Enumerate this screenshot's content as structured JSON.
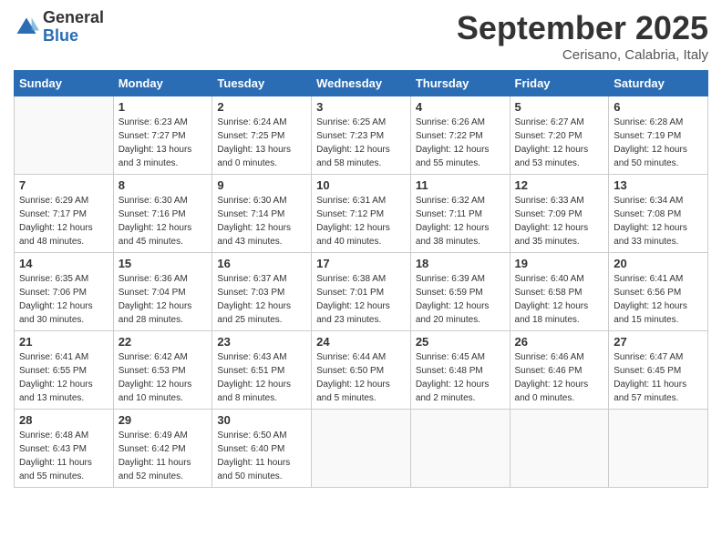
{
  "header": {
    "logo_general": "General",
    "logo_blue": "Blue",
    "month": "September 2025",
    "location": "Cerisano, Calabria, Italy"
  },
  "days_of_week": [
    "Sunday",
    "Monday",
    "Tuesday",
    "Wednesday",
    "Thursday",
    "Friday",
    "Saturday"
  ],
  "weeks": [
    [
      {
        "day": "",
        "info": ""
      },
      {
        "day": "1",
        "info": "Sunrise: 6:23 AM\nSunset: 7:27 PM\nDaylight: 13 hours\nand 3 minutes."
      },
      {
        "day": "2",
        "info": "Sunrise: 6:24 AM\nSunset: 7:25 PM\nDaylight: 13 hours\nand 0 minutes."
      },
      {
        "day": "3",
        "info": "Sunrise: 6:25 AM\nSunset: 7:23 PM\nDaylight: 12 hours\nand 58 minutes."
      },
      {
        "day": "4",
        "info": "Sunrise: 6:26 AM\nSunset: 7:22 PM\nDaylight: 12 hours\nand 55 minutes."
      },
      {
        "day": "5",
        "info": "Sunrise: 6:27 AM\nSunset: 7:20 PM\nDaylight: 12 hours\nand 53 minutes."
      },
      {
        "day": "6",
        "info": "Sunrise: 6:28 AM\nSunset: 7:19 PM\nDaylight: 12 hours\nand 50 minutes."
      }
    ],
    [
      {
        "day": "7",
        "info": "Sunrise: 6:29 AM\nSunset: 7:17 PM\nDaylight: 12 hours\nand 48 minutes."
      },
      {
        "day": "8",
        "info": "Sunrise: 6:30 AM\nSunset: 7:16 PM\nDaylight: 12 hours\nand 45 minutes."
      },
      {
        "day": "9",
        "info": "Sunrise: 6:30 AM\nSunset: 7:14 PM\nDaylight: 12 hours\nand 43 minutes."
      },
      {
        "day": "10",
        "info": "Sunrise: 6:31 AM\nSunset: 7:12 PM\nDaylight: 12 hours\nand 40 minutes."
      },
      {
        "day": "11",
        "info": "Sunrise: 6:32 AM\nSunset: 7:11 PM\nDaylight: 12 hours\nand 38 minutes."
      },
      {
        "day": "12",
        "info": "Sunrise: 6:33 AM\nSunset: 7:09 PM\nDaylight: 12 hours\nand 35 minutes."
      },
      {
        "day": "13",
        "info": "Sunrise: 6:34 AM\nSunset: 7:08 PM\nDaylight: 12 hours\nand 33 minutes."
      }
    ],
    [
      {
        "day": "14",
        "info": "Sunrise: 6:35 AM\nSunset: 7:06 PM\nDaylight: 12 hours\nand 30 minutes."
      },
      {
        "day": "15",
        "info": "Sunrise: 6:36 AM\nSunset: 7:04 PM\nDaylight: 12 hours\nand 28 minutes."
      },
      {
        "day": "16",
        "info": "Sunrise: 6:37 AM\nSunset: 7:03 PM\nDaylight: 12 hours\nand 25 minutes."
      },
      {
        "day": "17",
        "info": "Sunrise: 6:38 AM\nSunset: 7:01 PM\nDaylight: 12 hours\nand 23 minutes."
      },
      {
        "day": "18",
        "info": "Sunrise: 6:39 AM\nSunset: 6:59 PM\nDaylight: 12 hours\nand 20 minutes."
      },
      {
        "day": "19",
        "info": "Sunrise: 6:40 AM\nSunset: 6:58 PM\nDaylight: 12 hours\nand 18 minutes."
      },
      {
        "day": "20",
        "info": "Sunrise: 6:41 AM\nSunset: 6:56 PM\nDaylight: 12 hours\nand 15 minutes."
      }
    ],
    [
      {
        "day": "21",
        "info": "Sunrise: 6:41 AM\nSunset: 6:55 PM\nDaylight: 12 hours\nand 13 minutes."
      },
      {
        "day": "22",
        "info": "Sunrise: 6:42 AM\nSunset: 6:53 PM\nDaylight: 12 hours\nand 10 minutes."
      },
      {
        "day": "23",
        "info": "Sunrise: 6:43 AM\nSunset: 6:51 PM\nDaylight: 12 hours\nand 8 minutes."
      },
      {
        "day": "24",
        "info": "Sunrise: 6:44 AM\nSunset: 6:50 PM\nDaylight: 12 hours\nand 5 minutes."
      },
      {
        "day": "25",
        "info": "Sunrise: 6:45 AM\nSunset: 6:48 PM\nDaylight: 12 hours\nand 2 minutes."
      },
      {
        "day": "26",
        "info": "Sunrise: 6:46 AM\nSunset: 6:46 PM\nDaylight: 12 hours\nand 0 minutes."
      },
      {
        "day": "27",
        "info": "Sunrise: 6:47 AM\nSunset: 6:45 PM\nDaylight: 11 hours\nand 57 minutes."
      }
    ],
    [
      {
        "day": "28",
        "info": "Sunrise: 6:48 AM\nSunset: 6:43 PM\nDaylight: 11 hours\nand 55 minutes."
      },
      {
        "day": "29",
        "info": "Sunrise: 6:49 AM\nSunset: 6:42 PM\nDaylight: 11 hours\nand 52 minutes."
      },
      {
        "day": "30",
        "info": "Sunrise: 6:50 AM\nSunset: 6:40 PM\nDaylight: 11 hours\nand 50 minutes."
      },
      {
        "day": "",
        "info": ""
      },
      {
        "day": "",
        "info": ""
      },
      {
        "day": "",
        "info": ""
      },
      {
        "day": "",
        "info": ""
      }
    ]
  ]
}
